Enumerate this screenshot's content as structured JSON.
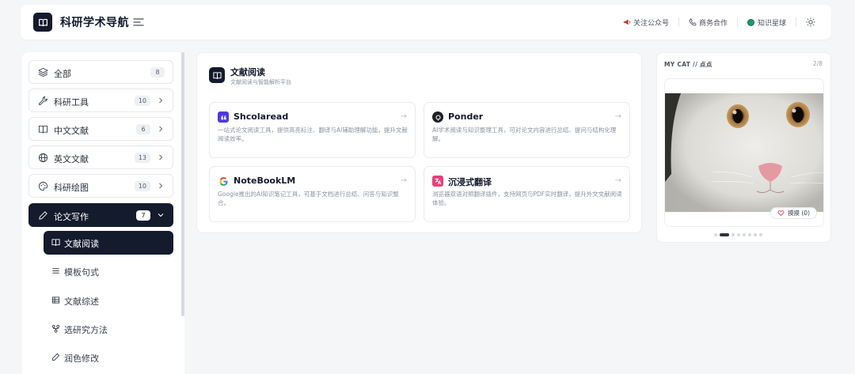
{
  "header": {
    "site_title": "科研学术导航",
    "links": [
      "关注公众号",
      "商务合作",
      "知识星球"
    ]
  },
  "sidebar": {
    "items": [
      {
        "label": "全部",
        "count": "8",
        "icon": "layers-icon"
      },
      {
        "label": "科研工具",
        "count": "10",
        "icon": "wrench-icon"
      },
      {
        "label": "中文文献",
        "count": "6",
        "icon": "book-icon"
      },
      {
        "label": "英文文献",
        "count": "13",
        "icon": "globe-icon"
      },
      {
        "label": "科研绘图",
        "count": "10",
        "icon": "palette-icon"
      },
      {
        "label": "论文写作",
        "count": "7",
        "icon": "pen-icon",
        "active": true
      }
    ],
    "subitems": [
      {
        "label": "文献阅读",
        "icon": "book-open-icon",
        "active": true
      },
      {
        "label": "模板句式",
        "icon": "list-icon"
      },
      {
        "label": "文献综述",
        "icon": "table-icon"
      },
      {
        "label": "选研究方法",
        "icon": "nodes-icon"
      },
      {
        "label": "润色修改",
        "icon": "pencil-icon"
      }
    ]
  },
  "main": {
    "section_title": "文献阅读",
    "section_subtitle": "文献阅读与智能解析平台",
    "cards": [
      {
        "name": "Shcolaread",
        "desc": "一站式论文阅读工具，提供高亮标注、翻译与AI辅助理解功能，提升文献阅读效率。",
        "icon": "quote-icon",
        "color": "#4a3be0"
      },
      {
        "name": "Ponder",
        "desc": "AI学术阅读与知识整理工具，可对论文内容进行总结、提问与结构化理解。",
        "icon": "ponder-icon",
        "color": "#1c1f26"
      },
      {
        "name": "NoteBookLM",
        "desc": "Google推出的AI知识笔记工具，可基于文档进行总结、问答与知识整合。",
        "icon": "google-icon",
        "color": "#4285f4"
      },
      {
        "name": "沉浸式翻译",
        "desc": "浏览器双语对照翻译插件，支持网页与PDF实时翻译，提升外文文献阅读体验。",
        "icon": "translate-icon",
        "color": "#e6407a"
      }
    ]
  },
  "rpanel": {
    "title": "MY CAT // 点点",
    "counter": "2/8",
    "like_label": "摸摸 (0)",
    "active_slide": 2,
    "slides": 8
  }
}
